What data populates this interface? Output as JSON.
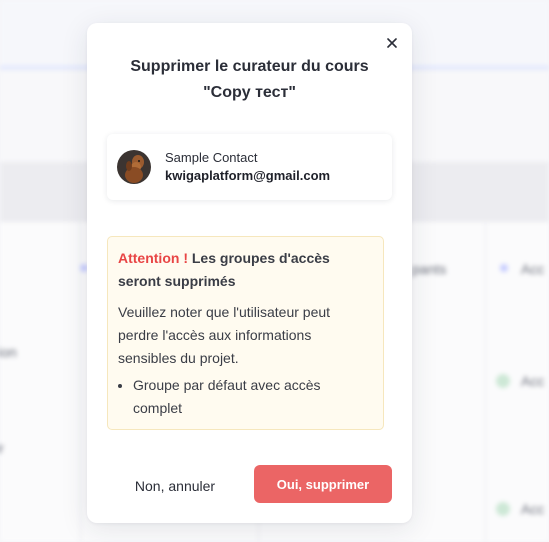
{
  "background": {
    "left_items": [
      "ion",
      "ir"
    ],
    "column_header": "pants",
    "right_header": "Acc",
    "right_items": [
      "Acc",
      "Acc"
    ]
  },
  "modal": {
    "title": "Supprimer le curateur du cours \"Copy тест\"",
    "close_icon": "close-icon",
    "contact": {
      "name": "Sample Contact",
      "email": "kwigaplatform@gmail.com",
      "avatar": "dog-avatar"
    },
    "alert": {
      "attention": "Attention !",
      "heading": "Les groupes d'accès seront supprimés",
      "body": "Veuillez noter que l'utilisateur peut perdre l'accès aux informations sensibles du projet.",
      "groups": [
        "Groupe par défaut avec accès complet"
      ]
    },
    "cancel_label": "Non, annuler",
    "confirm_label": "Oui, supprimer"
  },
  "colors": {
    "danger": "#eb6565",
    "attention": "#e84545",
    "alert_bg": "#fffbf0",
    "alert_border": "#f6e7bd"
  }
}
